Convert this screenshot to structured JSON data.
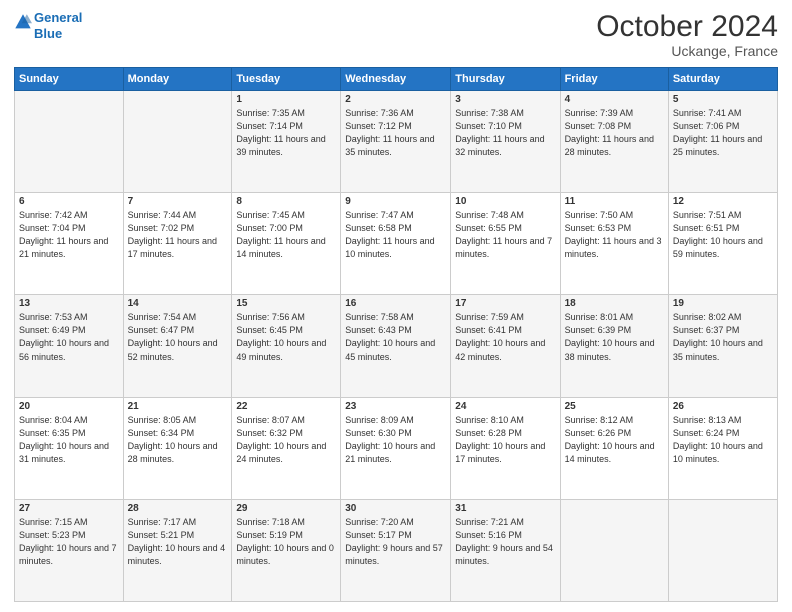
{
  "header": {
    "logo_line1": "General",
    "logo_line2": "Blue",
    "month": "October 2024",
    "location": "Uckange, France"
  },
  "weekdays": [
    "Sunday",
    "Monday",
    "Tuesday",
    "Wednesday",
    "Thursday",
    "Friday",
    "Saturday"
  ],
  "weeks": [
    [
      {
        "day": "",
        "info": ""
      },
      {
        "day": "",
        "info": ""
      },
      {
        "day": "1",
        "info": "Sunrise: 7:35 AM\nSunset: 7:14 PM\nDaylight: 11 hours\nand 39 minutes."
      },
      {
        "day": "2",
        "info": "Sunrise: 7:36 AM\nSunset: 7:12 PM\nDaylight: 11 hours\nand 35 minutes."
      },
      {
        "day": "3",
        "info": "Sunrise: 7:38 AM\nSunset: 7:10 PM\nDaylight: 11 hours\nand 32 minutes."
      },
      {
        "day": "4",
        "info": "Sunrise: 7:39 AM\nSunset: 7:08 PM\nDaylight: 11 hours\nand 28 minutes."
      },
      {
        "day": "5",
        "info": "Sunrise: 7:41 AM\nSunset: 7:06 PM\nDaylight: 11 hours\nand 25 minutes."
      }
    ],
    [
      {
        "day": "6",
        "info": "Sunrise: 7:42 AM\nSunset: 7:04 PM\nDaylight: 11 hours\nand 21 minutes."
      },
      {
        "day": "7",
        "info": "Sunrise: 7:44 AM\nSunset: 7:02 PM\nDaylight: 11 hours\nand 17 minutes."
      },
      {
        "day": "8",
        "info": "Sunrise: 7:45 AM\nSunset: 7:00 PM\nDaylight: 11 hours\nand 14 minutes."
      },
      {
        "day": "9",
        "info": "Sunrise: 7:47 AM\nSunset: 6:58 PM\nDaylight: 11 hours\nand 10 minutes."
      },
      {
        "day": "10",
        "info": "Sunrise: 7:48 AM\nSunset: 6:55 PM\nDaylight: 11 hours\nand 7 minutes."
      },
      {
        "day": "11",
        "info": "Sunrise: 7:50 AM\nSunset: 6:53 PM\nDaylight: 11 hours\nand 3 minutes."
      },
      {
        "day": "12",
        "info": "Sunrise: 7:51 AM\nSunset: 6:51 PM\nDaylight: 10 hours\nand 59 minutes."
      }
    ],
    [
      {
        "day": "13",
        "info": "Sunrise: 7:53 AM\nSunset: 6:49 PM\nDaylight: 10 hours\nand 56 minutes."
      },
      {
        "day": "14",
        "info": "Sunrise: 7:54 AM\nSunset: 6:47 PM\nDaylight: 10 hours\nand 52 minutes."
      },
      {
        "day": "15",
        "info": "Sunrise: 7:56 AM\nSunset: 6:45 PM\nDaylight: 10 hours\nand 49 minutes."
      },
      {
        "day": "16",
        "info": "Sunrise: 7:58 AM\nSunset: 6:43 PM\nDaylight: 10 hours\nand 45 minutes."
      },
      {
        "day": "17",
        "info": "Sunrise: 7:59 AM\nSunset: 6:41 PM\nDaylight: 10 hours\nand 42 minutes."
      },
      {
        "day": "18",
        "info": "Sunrise: 8:01 AM\nSunset: 6:39 PM\nDaylight: 10 hours\nand 38 minutes."
      },
      {
        "day": "19",
        "info": "Sunrise: 8:02 AM\nSunset: 6:37 PM\nDaylight: 10 hours\nand 35 minutes."
      }
    ],
    [
      {
        "day": "20",
        "info": "Sunrise: 8:04 AM\nSunset: 6:35 PM\nDaylight: 10 hours\nand 31 minutes."
      },
      {
        "day": "21",
        "info": "Sunrise: 8:05 AM\nSunset: 6:34 PM\nDaylight: 10 hours\nand 28 minutes."
      },
      {
        "day": "22",
        "info": "Sunrise: 8:07 AM\nSunset: 6:32 PM\nDaylight: 10 hours\nand 24 minutes."
      },
      {
        "day": "23",
        "info": "Sunrise: 8:09 AM\nSunset: 6:30 PM\nDaylight: 10 hours\nand 21 minutes."
      },
      {
        "day": "24",
        "info": "Sunrise: 8:10 AM\nSunset: 6:28 PM\nDaylight: 10 hours\nand 17 minutes."
      },
      {
        "day": "25",
        "info": "Sunrise: 8:12 AM\nSunset: 6:26 PM\nDaylight: 10 hours\nand 14 minutes."
      },
      {
        "day": "26",
        "info": "Sunrise: 8:13 AM\nSunset: 6:24 PM\nDaylight: 10 hours\nand 10 minutes."
      }
    ],
    [
      {
        "day": "27",
        "info": "Sunrise: 7:15 AM\nSunset: 5:23 PM\nDaylight: 10 hours\nand 7 minutes."
      },
      {
        "day": "28",
        "info": "Sunrise: 7:17 AM\nSunset: 5:21 PM\nDaylight: 10 hours\nand 4 minutes."
      },
      {
        "day": "29",
        "info": "Sunrise: 7:18 AM\nSunset: 5:19 PM\nDaylight: 10 hours\nand 0 minutes."
      },
      {
        "day": "30",
        "info": "Sunrise: 7:20 AM\nSunset: 5:17 PM\nDaylight: 9 hours\nand 57 minutes."
      },
      {
        "day": "31",
        "info": "Sunrise: 7:21 AM\nSunset: 5:16 PM\nDaylight: 9 hours\nand 54 minutes."
      },
      {
        "day": "",
        "info": ""
      },
      {
        "day": "",
        "info": ""
      }
    ]
  ]
}
